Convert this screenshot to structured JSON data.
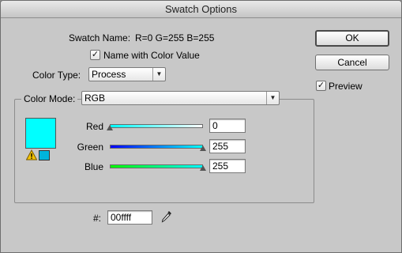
{
  "window": {
    "title": "Swatch Options"
  },
  "swatch_name": {
    "label": "Swatch Name:",
    "value": "R=0 G=255 B=255"
  },
  "name_with_value": {
    "label": "Name with Color Value",
    "checked": true,
    "mark": "✓"
  },
  "color_type": {
    "label": "Color Type:",
    "value": "Process"
  },
  "buttons": {
    "ok": "OK",
    "cancel": "Cancel"
  },
  "preview": {
    "label": "Preview",
    "checked": true,
    "mark": "✓"
  },
  "color_mode": {
    "label": "Color Mode:",
    "value": "RGB"
  },
  "swatch": {
    "color": "#00ffff",
    "web_safe_color": "#00b4dc"
  },
  "sliders": [
    {
      "label": "Red",
      "value": "0",
      "level": 0
    },
    {
      "label": "Green",
      "value": "255",
      "level": 1
    },
    {
      "label": "Blue",
      "value": "255",
      "level": 1
    }
  ],
  "hex": {
    "label": "#:",
    "value": "00ffff"
  },
  "icons": {
    "dropdown": "chevron-down-icon",
    "warning": "warning-icon",
    "eyedropper": "eyedropper-icon"
  }
}
